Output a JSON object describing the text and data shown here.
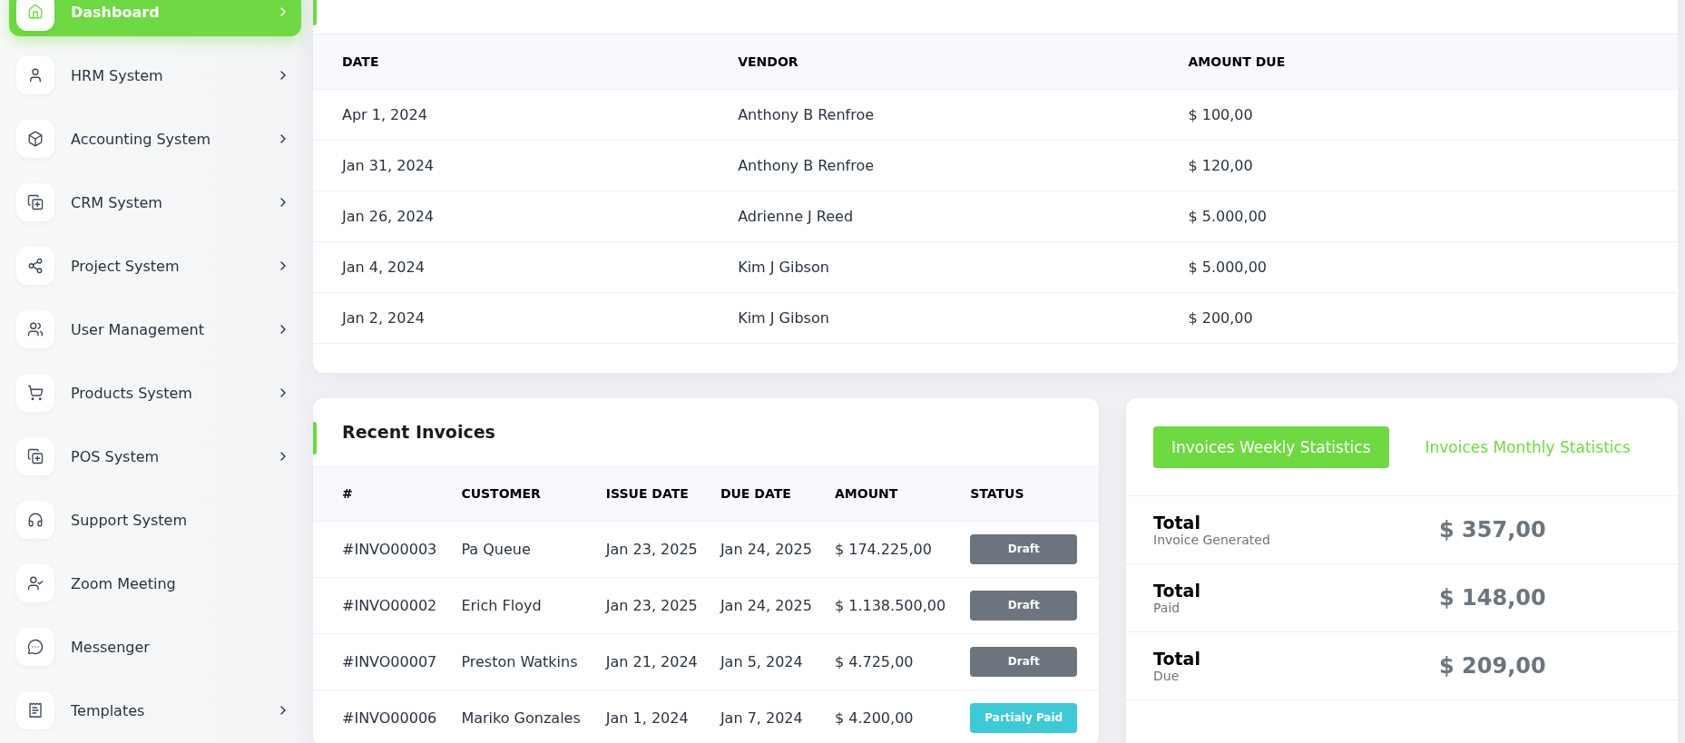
{
  "sidebar": {
    "items": [
      {
        "label": "Dashboard",
        "selected": true,
        "has_submenu": true
      },
      {
        "label": "HRM System",
        "selected": false,
        "has_submenu": true
      },
      {
        "label": "Accounting System",
        "selected": false,
        "has_submenu": true
      },
      {
        "label": "CRM System",
        "selected": false,
        "has_submenu": true
      },
      {
        "label": "Project System",
        "selected": false,
        "has_submenu": true
      },
      {
        "label": "User Management",
        "selected": false,
        "has_submenu": true
      },
      {
        "label": "Products System",
        "selected": false,
        "has_submenu": true
      },
      {
        "label": "POS System",
        "selected": false,
        "has_submenu": true
      },
      {
        "label": "Support System",
        "selected": false,
        "has_submenu": false
      },
      {
        "label": "Zoom Meeting",
        "selected": false,
        "has_submenu": false
      },
      {
        "label": "Messenger",
        "selected": false,
        "has_submenu": false
      },
      {
        "label": "Templates",
        "selected": false,
        "has_submenu": true
      }
    ]
  },
  "latest_expense": {
    "columns": [
      "DATE",
      "VENDOR",
      "AMOUNT DUE"
    ],
    "rows": [
      [
        "Apr 1, 2024",
        "Anthony B Renfroe",
        "$ 100,00"
      ],
      [
        "Jan 31, 2024",
        "Anthony B Renfroe",
        "$ 120,00"
      ],
      [
        "Jan 26, 2024",
        "Adrienne J Reed",
        "$ 5.000,00"
      ],
      [
        "Jan 4, 2024",
        "Kim J Gibson",
        "$ 5.000,00"
      ],
      [
        "Jan 2, 2024",
        "Kim J Gibson",
        "$ 200,00"
      ]
    ]
  },
  "recent_invoices": {
    "title": "Recent Invoices",
    "columns": [
      "#",
      "CUSTOMER",
      "ISSUE DATE",
      "DUE DATE",
      "AMOUNT",
      "STATUS"
    ],
    "rows": [
      {
        "number": "#INVO00003",
        "customer": "Pa Queue",
        "issue_date": "Jan 23, 2025",
        "due_date": "Jan 24, 2025",
        "amount": "$ 174.225,00",
        "status": {
          "label": "Draft",
          "kind": "draft"
        }
      },
      {
        "number": "#INVO00002",
        "customer": "Erich Floyd",
        "issue_date": "Jan 23, 2025",
        "due_date": "Jan 24, 2025",
        "amount": "$ 1.138.500,00",
        "status": {
          "label": "Draft",
          "kind": "draft"
        }
      },
      {
        "number": "#INVO00007",
        "customer": "Preston Watkins",
        "issue_date": "Jan 21, 2024",
        "due_date": "Jan 5, 2024",
        "amount": "$ 4.725,00",
        "status": {
          "label": "Draft",
          "kind": "draft"
        }
      },
      {
        "number": "#INVO00006",
        "customer": "Mariko Gonzales",
        "issue_date": "Jan 1, 2024",
        "due_date": "Jan 7, 2024",
        "amount": "$ 4.200,00",
        "status": {
          "label": "Partialy Paid",
          "kind": "partial"
        }
      }
    ]
  },
  "statistics": {
    "tabs": [
      {
        "label": "Invoices Weekly Statistics",
        "selected": true
      },
      {
        "label": "Invoices Monthly Statistics",
        "selected": false
      }
    ],
    "rows": [
      {
        "title": "Total",
        "subtitle": "Invoice Generated",
        "value": "$ 357,00"
      },
      {
        "title": "Total",
        "subtitle": "Paid",
        "value": "$ 148,00"
      },
      {
        "title": "Total",
        "subtitle": "Due",
        "value": "$ 209,00"
      }
    ]
  }
}
